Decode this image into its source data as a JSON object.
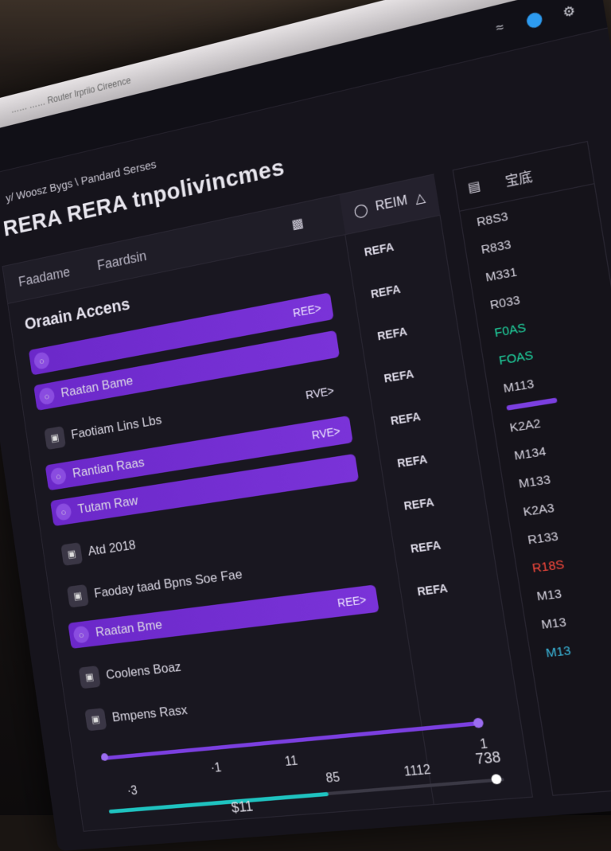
{
  "window": {
    "address_text": "…… …… Router Irpriio Cireence",
    "wifi_icon": "wifi-icon",
    "status_color": "#2d9bf0",
    "settings_icon": "gear-icon"
  },
  "breadcrumb": "y/ Woosz Bygs \\ Pandard Serses",
  "page_title": "RERA RERA tnpolivincmes",
  "tabs": {
    "tab1": "Faadame",
    "tab2": "Faardsin",
    "action_label": "REIM"
  },
  "section": {
    "title": "Oraain Accens",
    "rows": [
      {
        "label": "",
        "tag": "REE>",
        "highlight": true
      },
      {
        "label": "Raatan Bame",
        "tag": "",
        "highlight": true
      },
      {
        "label": "Faotiam Lins Lbs",
        "tag": "RVE>",
        "highlight": false
      },
      {
        "label": "Rantian Raas",
        "tag": "RVE>",
        "highlight": true
      },
      {
        "label": "Tutam Raw",
        "tag": "",
        "highlight": true
      },
      {
        "label": "Atd 2018",
        "tag": "",
        "highlight": false
      },
      {
        "label": "Faoday taad Bpns Soe Fae",
        "tag": "",
        "highlight": false
      },
      {
        "label": "Raatan Bme",
        "tag": "REE>",
        "highlight": true
      },
      {
        "label": "Coolens Boaz",
        "tag": "",
        "highlight": false
      },
      {
        "label": "Bmpens Rasx",
        "tag": "",
        "highlight": false
      }
    ]
  },
  "refa_column": [
    "REFA",
    "REFA",
    "REFA",
    "REFA",
    "REFA",
    "REFA",
    "REFA",
    "REFA",
    "REFA"
  ],
  "sliders": {
    "purple_label_top": "1",
    "purple_label_mid": "11",
    "purple_label_left": "·1",
    "grey_value": "738",
    "grey_label": "1",
    "teal_left": "·3",
    "teal_mid": "85",
    "teal_right": "1112",
    "bottom_value": "$11"
  },
  "right_panel": {
    "head_label": "宝底",
    "items": [
      {
        "text": "R8S3",
        "color": "default"
      },
      {
        "text": "R833",
        "color": "default"
      },
      {
        "text": "M331",
        "color": "default"
      },
      {
        "text": "R033",
        "color": "default"
      },
      {
        "text": "F0AS",
        "color": "green"
      },
      {
        "text": "FOAS",
        "color": "green"
      },
      {
        "text": "M113",
        "color": "default"
      },
      {
        "text": "K2A2",
        "color": "default"
      },
      {
        "text": "M134",
        "color": "default"
      },
      {
        "text": "M133",
        "color": "default"
      },
      {
        "text": "K2A3",
        "color": "default"
      },
      {
        "text": "R133",
        "color": "default"
      },
      {
        "text": "R18S",
        "color": "red"
      },
      {
        "text": "M13",
        "color": "default"
      },
      {
        "text": "M13",
        "color": "default"
      },
      {
        "text": "M13",
        "color": "teal"
      }
    ]
  }
}
